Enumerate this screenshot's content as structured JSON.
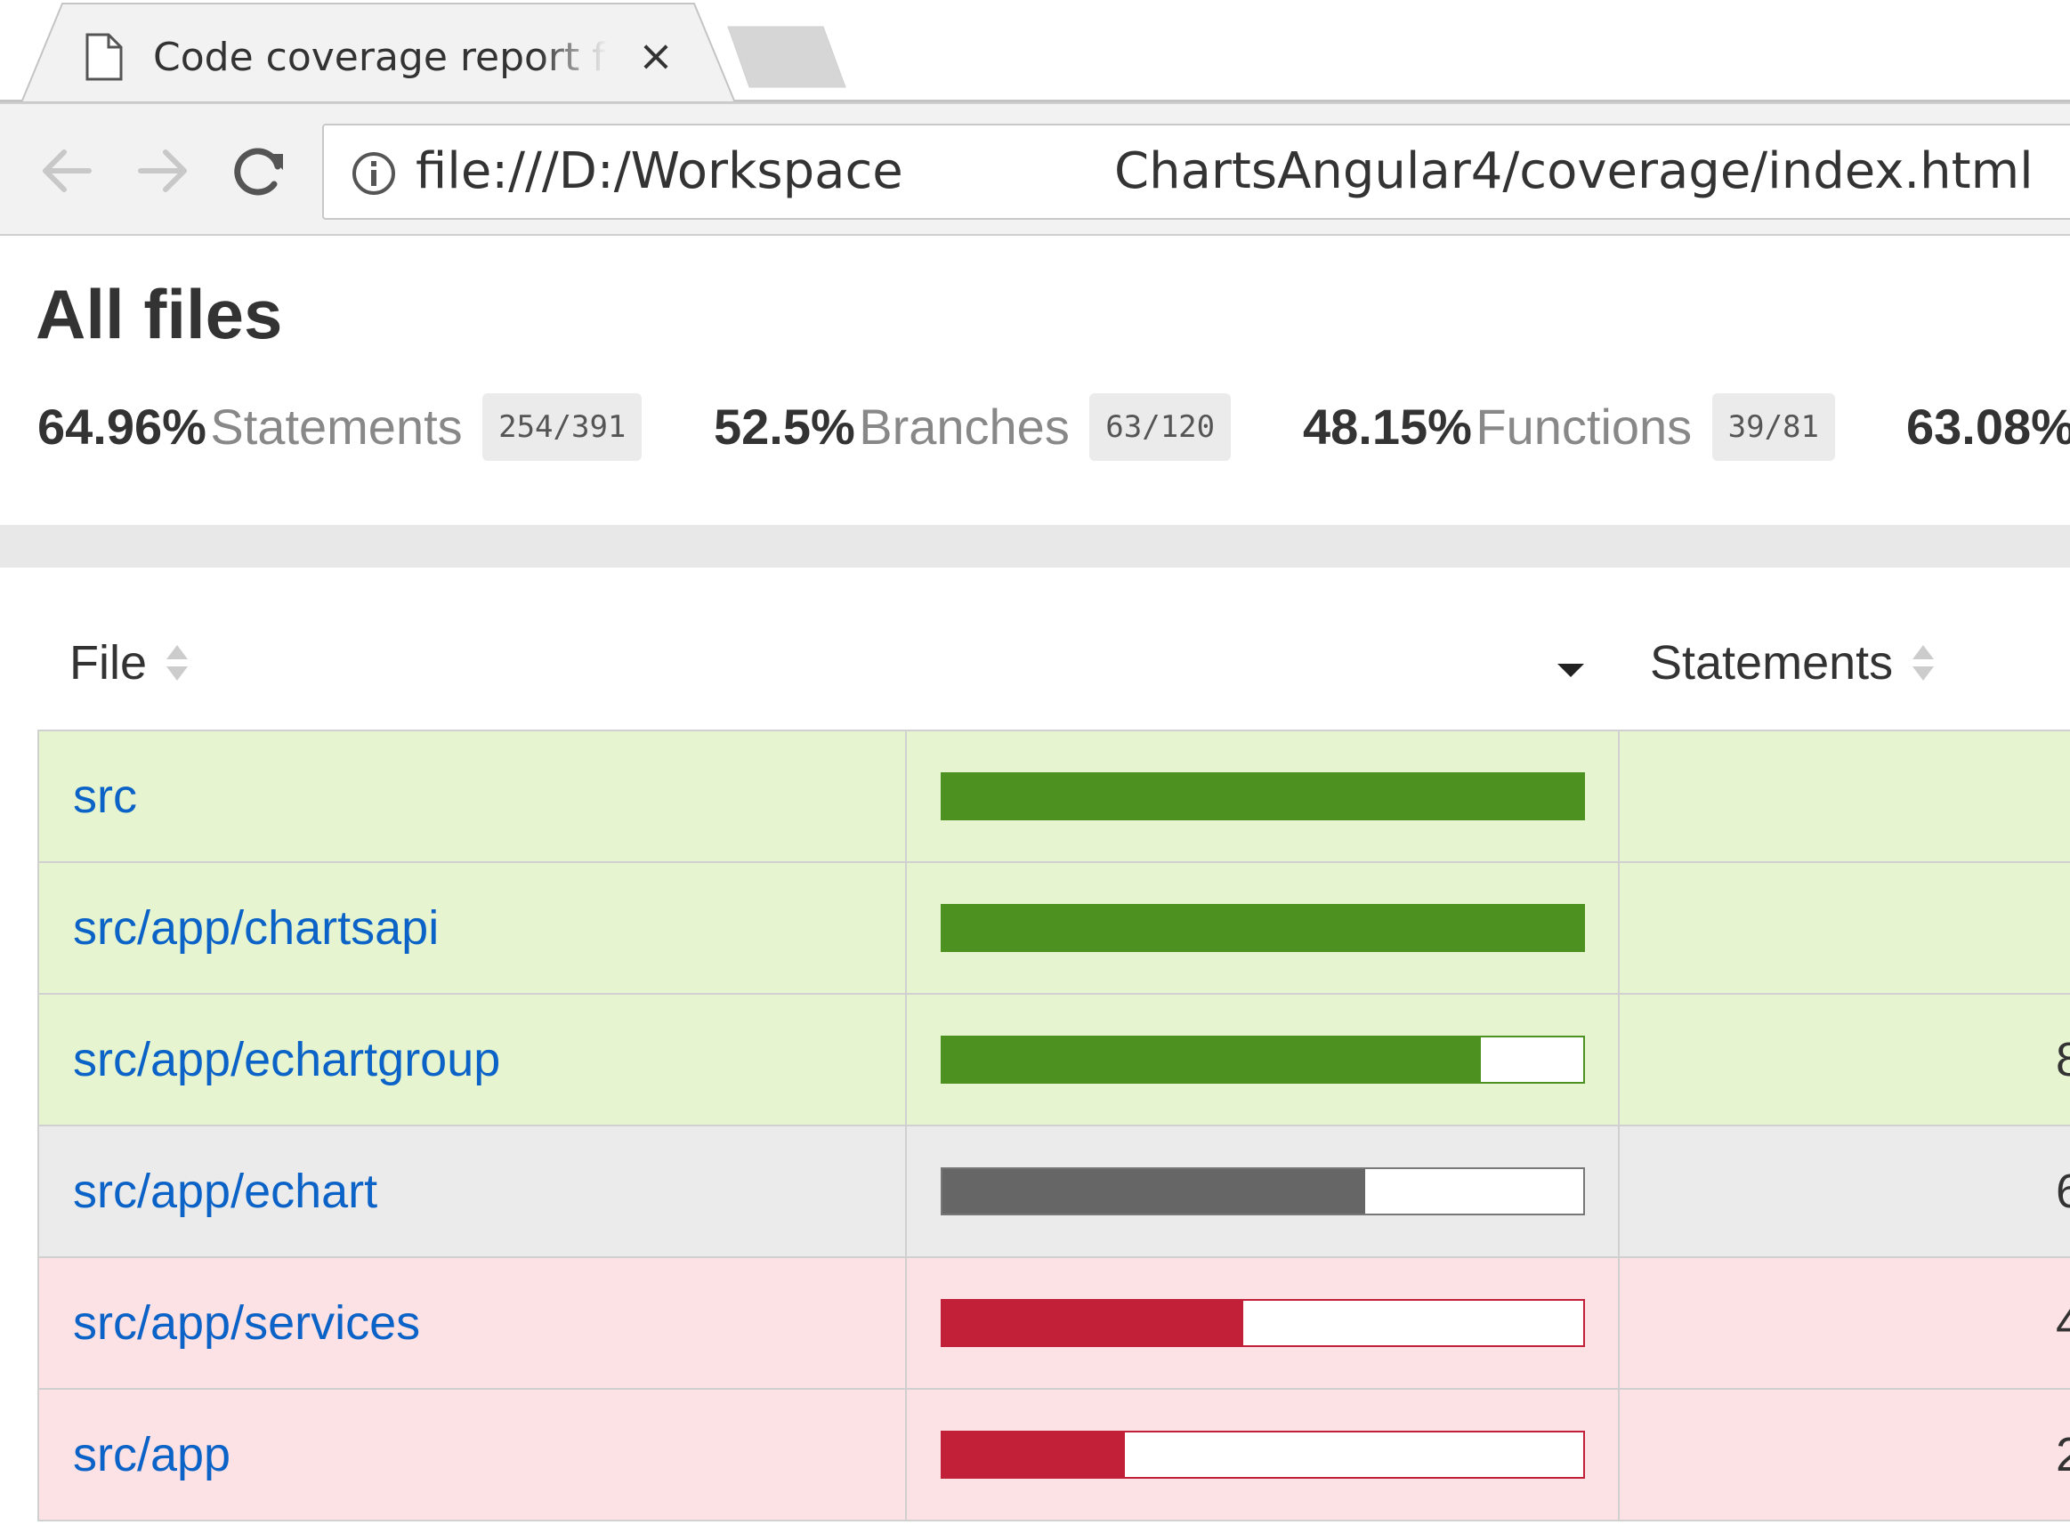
{
  "browser": {
    "tab_title": "Code coverage report for All files",
    "tab_close": "×",
    "url_left": "file:///D:/Workspace",
    "url_right": "ChartsAngular4/coverage/index.html"
  },
  "page": {
    "title": "All files",
    "summary": [
      {
        "pct": "64.96%",
        "label": "Statements",
        "fraction": "254/391"
      },
      {
        "pct": "52.5%",
        "label": "Branches",
        "fraction": "63/120"
      },
      {
        "pct": "48.15%",
        "label": "Functions",
        "fraction": "39/81"
      },
      {
        "pct": "63.08%"
      }
    ]
  },
  "table": {
    "headers": {
      "file": "File",
      "statements": "Statements"
    },
    "rows": [
      {
        "file": "src",
        "coverage": 100,
        "level": "high",
        "stmt_visible": ""
      },
      {
        "file": "src/app/chartsapi",
        "coverage": 100,
        "level": "high",
        "stmt_visible": ""
      },
      {
        "file": "src/app/echartgroup",
        "coverage": 84,
        "level": "high",
        "stmt_visible": "8"
      },
      {
        "file": "src/app/echart",
        "coverage": 66,
        "level": "medium",
        "stmt_visible": "6"
      },
      {
        "file": "src/app/services",
        "coverage": 47,
        "level": "low",
        "stmt_visible": "4"
      },
      {
        "file": "src/app",
        "coverage": 28.5,
        "level": "low",
        "stmt_visible": "2"
      }
    ]
  },
  "colors": {
    "high_bg": "#e6f5d0",
    "high_fill": "#4d9221",
    "medium_bg": "#ebebeb",
    "medium_fill": "#666666",
    "low_bg": "#fce1e5",
    "low_fill": "#c21f39",
    "link": "#0c63c7"
  },
  "icons": [
    "document-icon",
    "close-icon",
    "back-arrow-icon",
    "forward-arrow-icon",
    "reload-icon",
    "info-icon",
    "sort-icon",
    "sort-desc-icon"
  ]
}
